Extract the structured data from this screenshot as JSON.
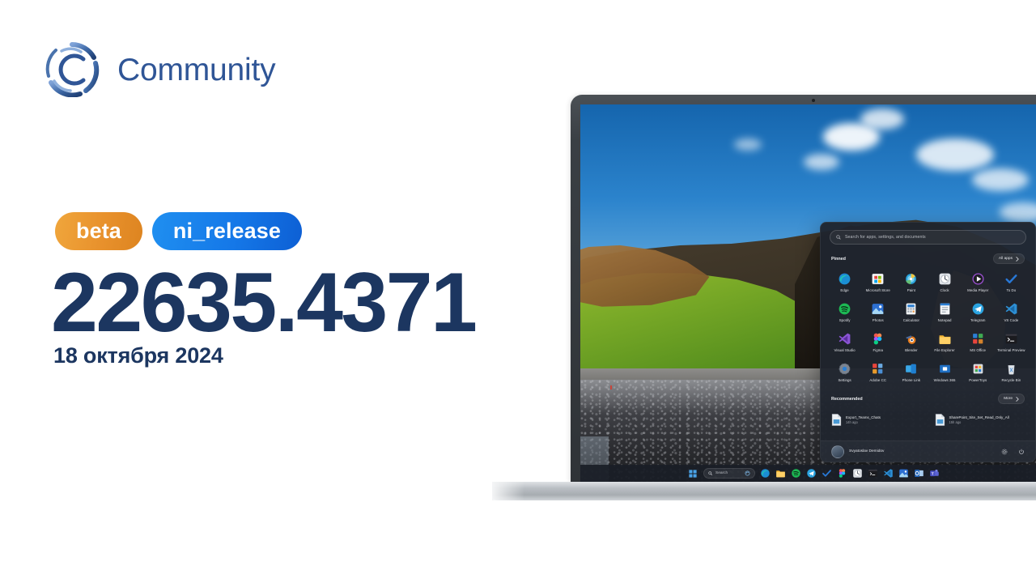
{
  "brand": {
    "name": "Community",
    "logo_icon": "community-c-logo-icon",
    "color": "#2f5596"
  },
  "release": {
    "channel_badge": "beta",
    "branch_badge": "ni_release",
    "build_number": "22635.4371",
    "date": "18 октября 2024",
    "badge_beta_color": "#e8912c",
    "badge_branch_color": "#1578e8",
    "text_color": "#1c3660"
  },
  "device": {
    "type": "laptop",
    "camera_icon": "webcam-icon"
  },
  "wallpaper": {
    "description": "black sand beach with grassy cliff under blue sky"
  },
  "start_menu": {
    "search": {
      "placeholder": "Search for apps, settings, and documents",
      "icon": "search-icon"
    },
    "pinned": {
      "title": "Pinned",
      "all_apps_label": "All apps",
      "all_apps_chevron": "chevron-right-icon",
      "apps": [
        {
          "label": "Edge",
          "icon": "edge-icon"
        },
        {
          "label": "Microsoft Store",
          "icon": "microsoft-store-icon"
        },
        {
          "label": "Paint",
          "icon": "paint-icon"
        },
        {
          "label": "Clock",
          "icon": "clock-icon"
        },
        {
          "label": "Media Player",
          "icon": "media-player-icon"
        },
        {
          "label": "To Do",
          "icon": "to-do-icon"
        },
        {
          "label": "Spotify",
          "icon": "spotify-icon"
        },
        {
          "label": "Photos",
          "icon": "photos-icon"
        },
        {
          "label": "Calculator",
          "icon": "calculator-icon"
        },
        {
          "label": "Notepad",
          "icon": "notepad-icon"
        },
        {
          "label": "Telegram",
          "icon": "telegram-icon"
        },
        {
          "label": "VS Code",
          "icon": "vs-code-icon"
        },
        {
          "label": "Visual Studio",
          "icon": "visual-studio-icon"
        },
        {
          "label": "Figma",
          "icon": "figma-icon"
        },
        {
          "label": "Blender",
          "icon": "blender-icon"
        },
        {
          "label": "File Explorer",
          "icon": "file-explorer-icon"
        },
        {
          "label": "MS Office",
          "icon": "ms-office-icon"
        },
        {
          "label": "Terminal Preview",
          "icon": "terminal-preview-icon"
        },
        {
          "label": "Settings",
          "icon": "settings-gear-icon"
        },
        {
          "label": "Adobe CC",
          "icon": "adobe-cc-icon"
        },
        {
          "label": "Phone Link",
          "icon": "phone-link-icon"
        },
        {
          "label": "Windows 365",
          "icon": "windows-365-icon"
        },
        {
          "label": "PowerToys",
          "icon": "powertoys-icon"
        },
        {
          "label": "Recycle Bin",
          "icon": "recycle-bin-icon"
        }
      ]
    },
    "recommended": {
      "title": "Recommended",
      "more_label": "More",
      "more_chevron": "chevron-right-icon",
      "items": [
        {
          "name": "Export_Teams_Chats",
          "time": "14h ago",
          "icon": "document-icon"
        },
        {
          "name": "SharePoint_Site_Set_Read_Only_All",
          "time": "15h ago",
          "icon": "document-icon"
        }
      ]
    },
    "footer": {
      "user_name": "Svyatoslav Demidov",
      "avatar_icon": "avatar-icon",
      "settings_icon": "settings-gear-icon",
      "power_icon": "power-icon"
    }
  },
  "taskbar": {
    "start_icon": "windows-start-icon",
    "search_label": "Search",
    "search_icon": "search-icon",
    "copilot_icon": "copilot-icon",
    "apps": [
      {
        "icon": "edge-icon"
      },
      {
        "icon": "file-explorer-icon"
      },
      {
        "icon": "spotify-icon"
      },
      {
        "icon": "telegram-icon"
      },
      {
        "icon": "to-do-icon"
      },
      {
        "icon": "figma-icon"
      },
      {
        "icon": "clock-icon"
      },
      {
        "icon": "terminal-preview-icon"
      },
      {
        "icon": "vs-code-icon"
      },
      {
        "icon": "photos-icon"
      },
      {
        "icon": "outlook-icon"
      },
      {
        "icon": "teams-icon"
      }
    ]
  }
}
